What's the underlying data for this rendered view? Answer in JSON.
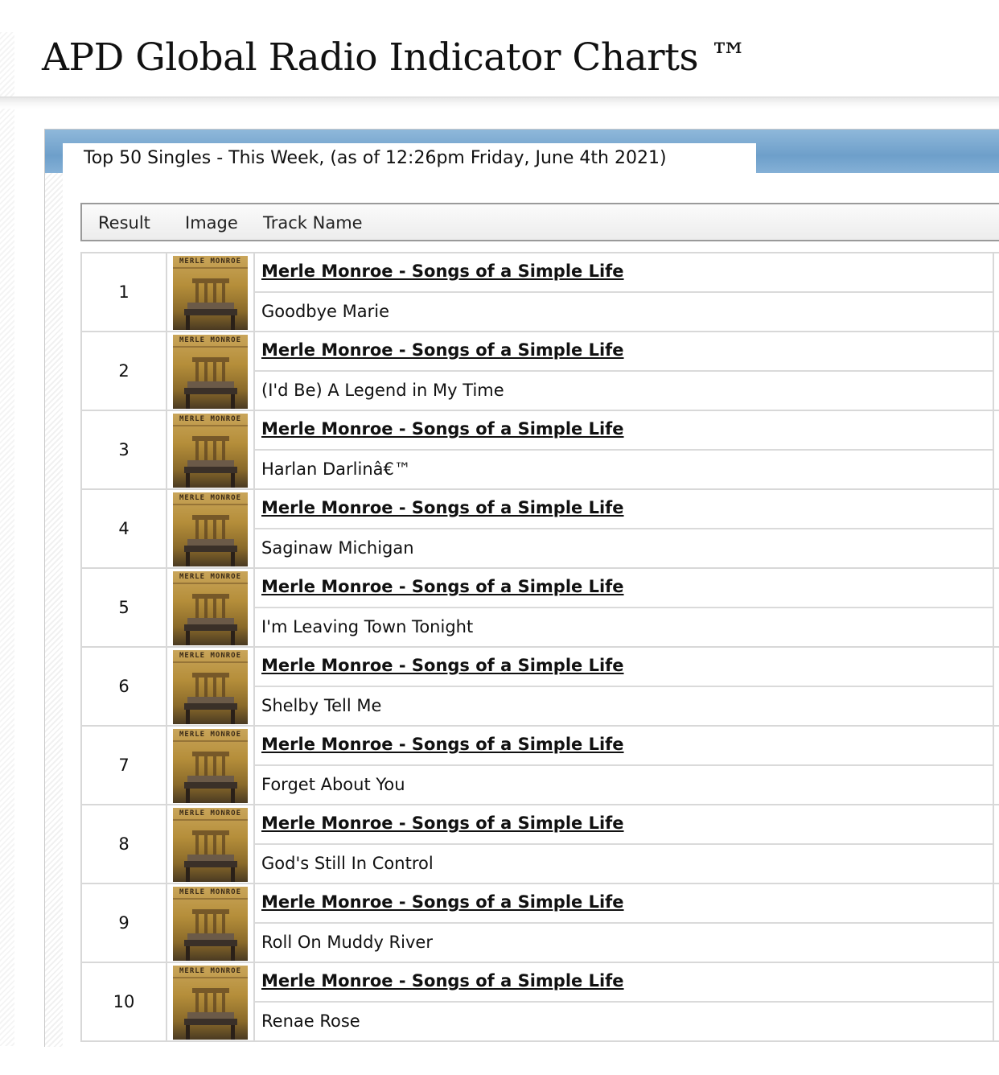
{
  "page": {
    "title": "APD Global Radio Indicator Charts ™"
  },
  "panel": {
    "tab_label": "Top 50 Singles - This Week, (as of 12:26pm Friday, June 4th 2021)"
  },
  "table": {
    "columns": [
      "Result",
      "Image",
      "Track Name"
    ],
    "rows": [
      {
        "rank": "1",
        "album": "Merle Monroe - Songs of a Simple Life",
        "track": "Goodbye Marie",
        "cover_text": "MERLE MONROE"
      },
      {
        "rank": "2",
        "album": "Merle Monroe - Songs of a Simple Life",
        "track": "(I'd Be) A Legend in My Time",
        "cover_text": "MERLE MONROE"
      },
      {
        "rank": "3",
        "album": "Merle Monroe - Songs of a Simple Life",
        "track": "Harlan Darlinâ€™",
        "cover_text": "MERLE MONROE"
      },
      {
        "rank": "4",
        "album": "Merle Monroe - Songs of a Simple Life",
        "track": "Saginaw Michigan",
        "cover_text": "MERLE MONROE"
      },
      {
        "rank": "5",
        "album": "Merle Monroe - Songs of a Simple Life",
        "track": "I'm Leaving Town Tonight",
        "cover_text": "MERLE MONROE"
      },
      {
        "rank": "6",
        "album": "Merle Monroe - Songs of a Simple Life",
        "track": "Shelby Tell Me",
        "cover_text": "MERLE MONROE"
      },
      {
        "rank": "7",
        "album": "Merle Monroe - Songs of a Simple Life",
        "track": "Forget About You",
        "cover_text": "MERLE MONROE"
      },
      {
        "rank": "8",
        "album": "Merle Monroe - Songs of a Simple Life",
        "track": "God's Still In Control",
        "cover_text": "MERLE MONROE"
      },
      {
        "rank": "9",
        "album": "Merle Monroe - Songs of a Simple Life",
        "track": "Roll On Muddy River",
        "cover_text": "MERLE MONROE"
      },
      {
        "rank": "10",
        "album": "Merle Monroe - Songs of a Simple Life",
        "track": "Renae Rose",
        "cover_text": "MERLE MONROE"
      }
    ]
  },
  "colors": {
    "header_blue": "#6e9fca",
    "row_border": "#d8d8d8",
    "text": "#111111"
  },
  "icons": {
    "album_cover": "album-cover-chair-image"
  }
}
